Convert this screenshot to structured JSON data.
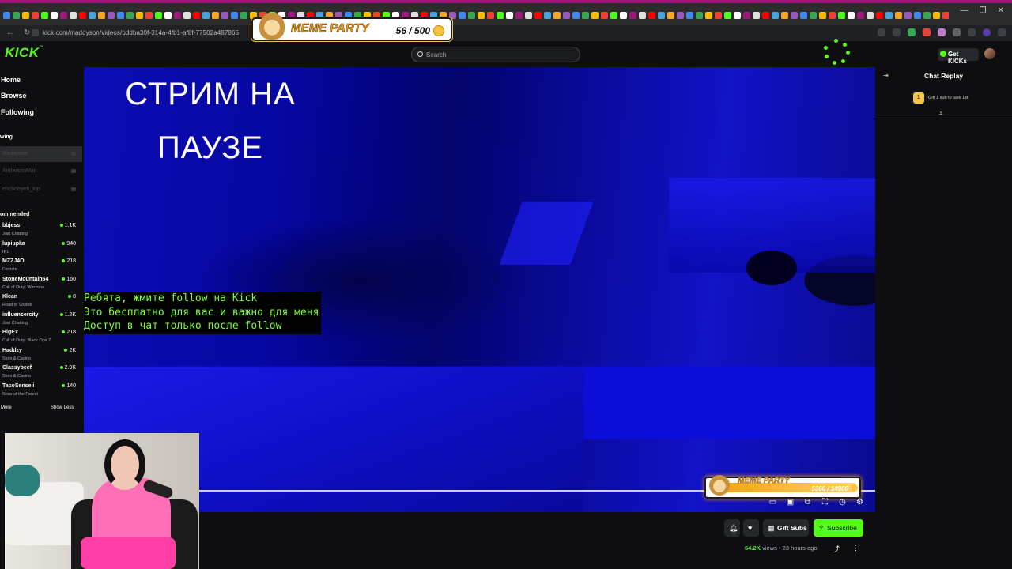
{
  "browser": {
    "url": "kick.com/maddyson/videos/bddba30f-314a-4fb1-af8f-77502a487865",
    "tab_colors": [
      "#4285f4",
      "#34a853",
      "#fbbc05",
      "#ea4335",
      "#53fc18",
      "#ffffff",
      "#a0187e",
      "#e0e0e0",
      "#ff0000",
      "#4aa3df",
      "#f5a623",
      "#9b59b6"
    ]
  },
  "overlay_top": {
    "title": "MEME PARTY",
    "count": "56 / 500"
  },
  "header": {
    "logo": "KICK",
    "search_placeholder": "Search",
    "get_kicks_label": "Get KICKs"
  },
  "sidebar": {
    "nav": [
      {
        "label": "Home"
      },
      {
        "label": "Browse"
      },
      {
        "label": "Following"
      }
    ],
    "following_heading": "wing",
    "following": [
      {
        "name": "Maddyson"
      },
      {
        "name": "AndersonMan"
      },
      {
        "name": "ehchobyeh_top"
      }
    ],
    "recommended_heading": "ommended",
    "recommended": [
      {
        "name": "bbjess",
        "category": "Just Chatting",
        "viewers": "1.1K"
      },
      {
        "name": "lupiupka",
        "category": "IRL",
        "viewers": "940"
      },
      {
        "name": "MZZJ4O",
        "category": "Fortnite",
        "viewers": "218"
      },
      {
        "name": "StoneMountain64",
        "category": "Call of Duty: Warzone",
        "viewers": "160"
      },
      {
        "name": "Klean",
        "category": "Road to Vostok",
        "viewers": "8"
      },
      {
        "name": "influencercity",
        "category": "Just Chatting",
        "viewers": "1.2K"
      },
      {
        "name": "BigEx",
        "category": "Call of Duty: Black Ops 7",
        "viewers": "218"
      },
      {
        "name": "Haddzy",
        "category": "Slots & Casino",
        "viewers": "2K"
      },
      {
        "name": "Classybeef",
        "category": "Slots & Casino",
        "viewers": "2.9K"
      },
      {
        "name": "TacoSenseii",
        "category": "Sons of the Forest",
        "viewers": "140"
      }
    ],
    "show_more": "More",
    "show_less": "Show Less"
  },
  "video": {
    "title_lines": [
      "СТРИМ НА",
      "ПАУЗЕ"
    ],
    "message_lines": [
      "Ребята, жмите follow на Kick",
      "Это бесплатно для вас и важно для меня",
      "Доступ в чат только после follow"
    ],
    "overlay_bottom": {
      "title": "MEME PARTY",
      "count": "5360 / 14900"
    },
    "controls": [
      "theater-icon",
      "clip-icon",
      "pip-icon",
      "fullscreen-icon",
      "speed-icon",
      "settings-icon"
    ]
  },
  "actions": {
    "gift_subs_label": "Gift Subs",
    "subscribe_label": "Subscribe",
    "views": "64.2K",
    "views_suffix": "views",
    "separator": "•",
    "time_ago": "23 hours ago"
  },
  "chat": {
    "title": "Chat Replay",
    "gift_badge": "1",
    "gift_text": "Gift 1 sub to take 1st"
  },
  "colors": {
    "kick_green": "#53fc18",
    "background": "#0e0e10",
    "video_blue": "#0a0aa8",
    "message_green": "#7dfb36"
  }
}
